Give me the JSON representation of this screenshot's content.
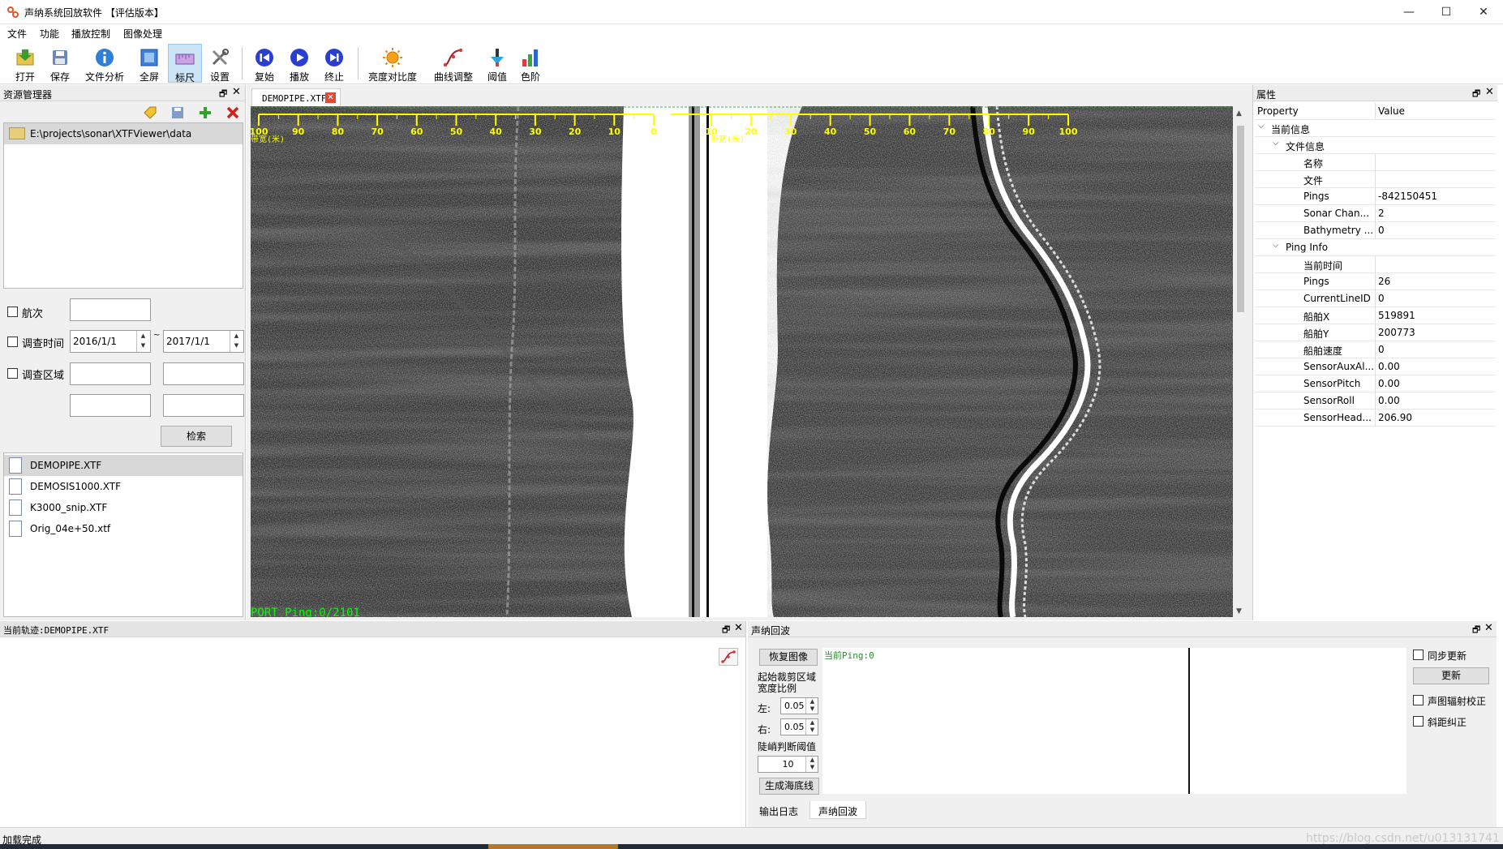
{
  "window": {
    "title": "声纳系统回放软件 【评估版本】",
    "minimize_glyph": "—",
    "maximize_glyph": "☐",
    "close_glyph": "✕"
  },
  "menu": [
    "文件",
    "功能",
    "播放控制",
    "图像处理"
  ],
  "toolbar": {
    "group1": [
      "打开",
      "保存",
      "文件分析",
      "全屏",
      "标尺",
      "设置"
    ],
    "group2": [
      "复始",
      "播放",
      "终止"
    ],
    "group3": [
      "亮度对比度",
      "曲线调整",
      "阈值",
      "色阶"
    ]
  },
  "explorer": {
    "title": "资源管理器",
    "folder_path": "E:\\projects\\sonar\\XTFViewer\\data",
    "filters": {
      "cruise_label": "航次",
      "time_label": "调查时间",
      "date_from": "2016/1/1",
      "date_sep": "~",
      "date_to": "2017/1/1",
      "area_label": "调查区域",
      "search_button": "检索"
    },
    "files": [
      "DEMOPIPE.XTF",
      "DEMOSIS1000.XTF",
      "K3000_snip.XTF",
      "Orig_04e+50.xtf"
    ],
    "selected_file": "DEMOPIPE.XTF"
  },
  "document": {
    "tab_label": "DEMOPIPE.XTF",
    "port_scale_label": "带宽(米)",
    "stbd_scale_label": "带宽(米)",
    "port_ticks": [
      "100",
      "90",
      "80",
      "70",
      "60",
      "50",
      "40",
      "30",
      "20",
      "10",
      "0"
    ],
    "stbd_ticks": [
      "10",
      "20",
      "30",
      "40",
      "50",
      "60",
      "70",
      "80",
      "90",
      "100"
    ],
    "ping_status": "PORT Ping:0/2101",
    "scale_color": "#ffff00",
    "status_color": "#00ff00"
  },
  "properties": {
    "title": "属性",
    "col_property": "Property",
    "col_value": "Value",
    "rows": [
      {
        "key": "当前信息",
        "value": "",
        "level": 0,
        "category": true
      },
      {
        "key": "文件信息",
        "value": "",
        "level": 1,
        "category": true
      },
      {
        "key": "名称",
        "value": "",
        "level": 2
      },
      {
        "key": "文件",
        "value": "",
        "level": 2
      },
      {
        "key": "Pings",
        "value": "-842150451",
        "level": 2
      },
      {
        "key": "Sonar Chan...",
        "value": "2",
        "level": 2
      },
      {
        "key": "Bathymetry ...",
        "value": "0",
        "level": 2
      },
      {
        "key": "Ping Info",
        "value": "",
        "level": 1,
        "category": true
      },
      {
        "key": "当前时间",
        "value": "",
        "level": 2
      },
      {
        "key": "Pings",
        "value": "26",
        "level": 2
      },
      {
        "key": "CurrentLineID",
        "value": "0",
        "level": 2
      },
      {
        "key": "船舶X",
        "value": "519891",
        "level": 2
      },
      {
        "key": "船舶Y",
        "value": "200773",
        "level": 2
      },
      {
        "key": "船舶速度",
        "value": "0",
        "level": 2
      },
      {
        "key": "SensorAuxAl...",
        "value": "0.00",
        "level": 2
      },
      {
        "key": "SensorPitch",
        "value": "0.00",
        "level": 2
      },
      {
        "key": "SensorRoll",
        "value": "0.00",
        "level": 2
      },
      {
        "key": "SensorHead...",
        "value": "206.90",
        "level": 2
      }
    ]
  },
  "track": {
    "title": "当前轨迹:DEMOPIPE.XTF"
  },
  "echo": {
    "title": "声纳回波",
    "restore_button": "恢复图像",
    "crop_label_1": "起始裁剪区域",
    "crop_label_2": "宽度比例",
    "left_label": "左:",
    "left_value": "0.05",
    "right_label": "右:",
    "right_value": "0.05",
    "threshold_label": "陡峭判断阈值",
    "threshold_value": "10",
    "gen_button": "生成海底线",
    "current_ping": "当前Ping:0",
    "sync_label": "同步更新",
    "update_button": "更新",
    "radiometric_label": "声图辐射校正",
    "slant_label": "斜距纠正",
    "tabs": [
      "输出日志",
      "声纳回波"
    ],
    "active_tab": "声纳回波"
  },
  "statusbar": {
    "text": "加载完成",
    "watermark": "https://blog.csdn.net/u013131741"
  }
}
